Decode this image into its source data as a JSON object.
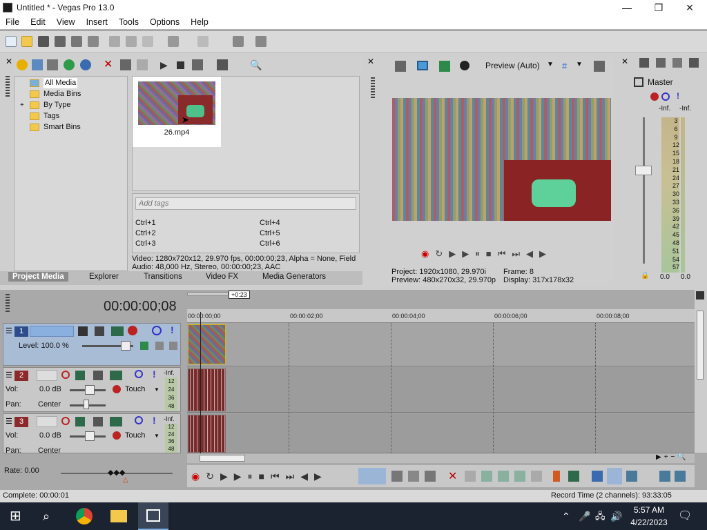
{
  "window": {
    "title": "Untitled * - Vegas Pro 13.0",
    "minimize": "—",
    "maximize": "❐",
    "close": "✕"
  },
  "menu": [
    "File",
    "Edit",
    "View",
    "Insert",
    "Tools",
    "Options",
    "Help"
  ],
  "project_media": {
    "tree": [
      "All Media",
      "Media Bins",
      "By Type",
      "Tags",
      "Smart Bins"
    ],
    "expander": "+",
    "thumbnail_name": "26.mp4",
    "tags_placeholder": "Add tags",
    "shortcuts": [
      "Ctrl+1",
      "Ctrl+4",
      "Ctrl+2",
      "Ctrl+5",
      "Ctrl+3",
      "Ctrl+6"
    ],
    "video_info": "Video: 1280x720x12, 29.970 fps, 00:00:00;23, Alpha = None, Field",
    "audio_info": "Audio: 48,000 Hz, Stereo, 00:00:00;23, AAC"
  },
  "tabs": [
    "Project Media",
    "Explorer",
    "Transitions",
    "Video FX",
    "Media Generators"
  ],
  "preview": {
    "mode": "Preview (Auto)",
    "project": "Project:   1920x1080, 29.970i",
    "preview": "Preview:  480x270x32, 29.970p",
    "frame": "Frame:    8",
    "display": "Display:   317x178x32"
  },
  "mixer": {
    "title": "Master",
    "left_peak": "-Inf.",
    "right_peak": "-Inf.",
    "scale": [
      "3",
      "6",
      "9",
      "12",
      "15",
      "18",
      "21",
      "24",
      "27",
      "30",
      "33",
      "36",
      "39",
      "42",
      "45",
      "48",
      "51",
      "54",
      "57"
    ],
    "left_value": "0.0",
    "right_value": "0.0"
  },
  "timeline": {
    "timecode": "00:00:00;08",
    "length": "+0:23",
    "ruler": [
      "00:00:00;00",
      "00:00:02;00",
      "00:00:04;00",
      "00:00:06;00",
      "00:00:08;00"
    ],
    "track1": {
      "num": "1",
      "level": "Level: 100.0 %"
    },
    "track2": {
      "num": "2",
      "vol_label": "Vol:",
      "vol": "0.0 dB",
      "pan_label": "Pan:",
      "pan": "Center",
      "mode": "Touch",
      "peak": "-Inf.",
      "meter": [
        "12",
        "24",
        "36",
        "48"
      ]
    },
    "track3": {
      "num": "3",
      "vol_label": "Vol:",
      "vol": "0.0 dB",
      "pan_label": "Pan:",
      "pan": "Center",
      "mode": "Touch",
      "peak": "-Inf.",
      "meter": [
        "12",
        "24",
        "36",
        "48"
      ]
    }
  },
  "rate": "Rate: 0.00",
  "status": {
    "left": "Complete: 00:00:01",
    "right": "Record Time (2 channels): 93:33:05"
  },
  "taskbar": {
    "time": "5:57 AM",
    "date": "4/22/2023"
  }
}
